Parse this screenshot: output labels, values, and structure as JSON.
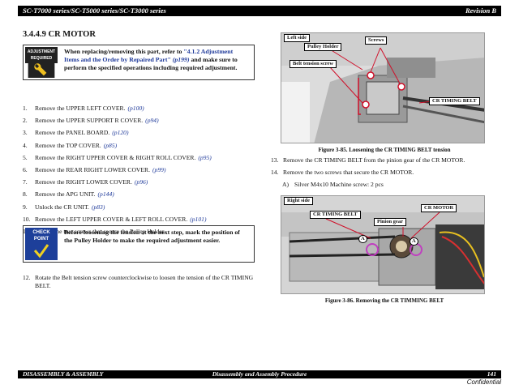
{
  "header": {
    "left": "SC-T7000 series/SC-T5000 series/SC-T3000 series",
    "right": "Revision B"
  },
  "footer": {
    "left": "DISASSEMBLY & ASSEMBLY",
    "center": "Disassembly and Assembly Procedure",
    "right": "141",
    "confidential": "Confidential"
  },
  "section_title": "3.4.4.9  CR MOTOR",
  "adjustment_note": {
    "icon_label_1": "ADJUSTMENT",
    "icon_label_2": "REQUIRED",
    "text_pre": "When replacing/removing this part, refer to ",
    "link": "\"4.1.2  Adjustment Items and the Order by Repaired Part\"",
    "page": "(p199)",
    "text_post": " and make sure to perform the specified operations including required adjustment."
  },
  "steps": [
    {
      "num": "1.",
      "text": "Remove the UPPER LEFT COVER.",
      "ref": "(p100)"
    },
    {
      "num": "2.",
      "text": "Remove the UPPER SUPPORT R COVER.",
      "ref": "(p94)"
    },
    {
      "num": "3.",
      "text": "Remove the PANEL BOARD.",
      "ref": "(p120)"
    },
    {
      "num": "4.",
      "text": "Remove the TOP COVER.",
      "ref": "(p85)"
    },
    {
      "num": "5.",
      "text": "Remove the RIGHT UPPER COVER & RIGHT ROLL COVER.",
      "ref": "(p95)"
    },
    {
      "num": "6.",
      "text": "Remove the REAR RIGHT LOWER COVER.",
      "ref": "(p99)"
    },
    {
      "num": "7.",
      "text": "Remove the RIGHT LOWER COVER.",
      "ref": "(p96)"
    },
    {
      "num": "8.",
      "text": "Remove the APG UNIT.",
      "ref": "(p144)"
    },
    {
      "num": "9.",
      "text": "Unlock the CR UNIT.",
      "ref": "(p83)"
    },
    {
      "num": "10.",
      "text": "Remove the LEFT UPPER COVER & LEFT ROLL COVER.",
      "ref": "(p101)"
    },
    {
      "num": "11.",
      "text": "Loosen the two screws that secure the Pulley Holder.",
      "ref": ""
    }
  ],
  "check_note": {
    "icon_label_1": "CHECK",
    "icon_label_2": "POINT",
    "text": "Before loosening the tension at the next step, mark the position of the Pulley Holder to make the required adjustment easier."
  },
  "step12": {
    "num": "12.",
    "text": "Rotate the Belt tension screw counterclockwise to loosen the tension of the CR TIMING BELT."
  },
  "figure85": {
    "labels": {
      "left_side": "Left side",
      "pulley_holder": "Pulley Holder",
      "screws": "Screws",
      "belt_tension_screw": "Belt tension screw",
      "cr_timing_belt": "CR TIMING BELT"
    },
    "caption": "Figure 3-85.  Loosening the CR TIMING BELT tension"
  },
  "step13": {
    "num": "13.",
    "text": "Remove the CR TIMING BELT from the pinion gear of the CR MOTOR."
  },
  "step14": {
    "num": "14.",
    "text": "Remove the two screws that secure the CR MOTOR."
  },
  "step14a": {
    "num": "A)",
    "text": "Silver M4x10 Machine screw: 2 pcs"
  },
  "figure86": {
    "labels": {
      "right_side": "Right side",
      "cr_timing_belt": "CR TIMING BELT",
      "cr_motor": "CR MOTOR",
      "pinion_gear": "Pinion gear",
      "a1": "A",
      "a2": "A"
    },
    "caption": "Figure 3-86.  Removing the CR TIMMING BELT"
  },
  "colors": {
    "link": "#1f3a9a",
    "icon_blue": "#1d3f9a",
    "icon_dark": "#222222",
    "highlight_red": "#d0102a",
    "screw_circle": "#c040c0"
  }
}
